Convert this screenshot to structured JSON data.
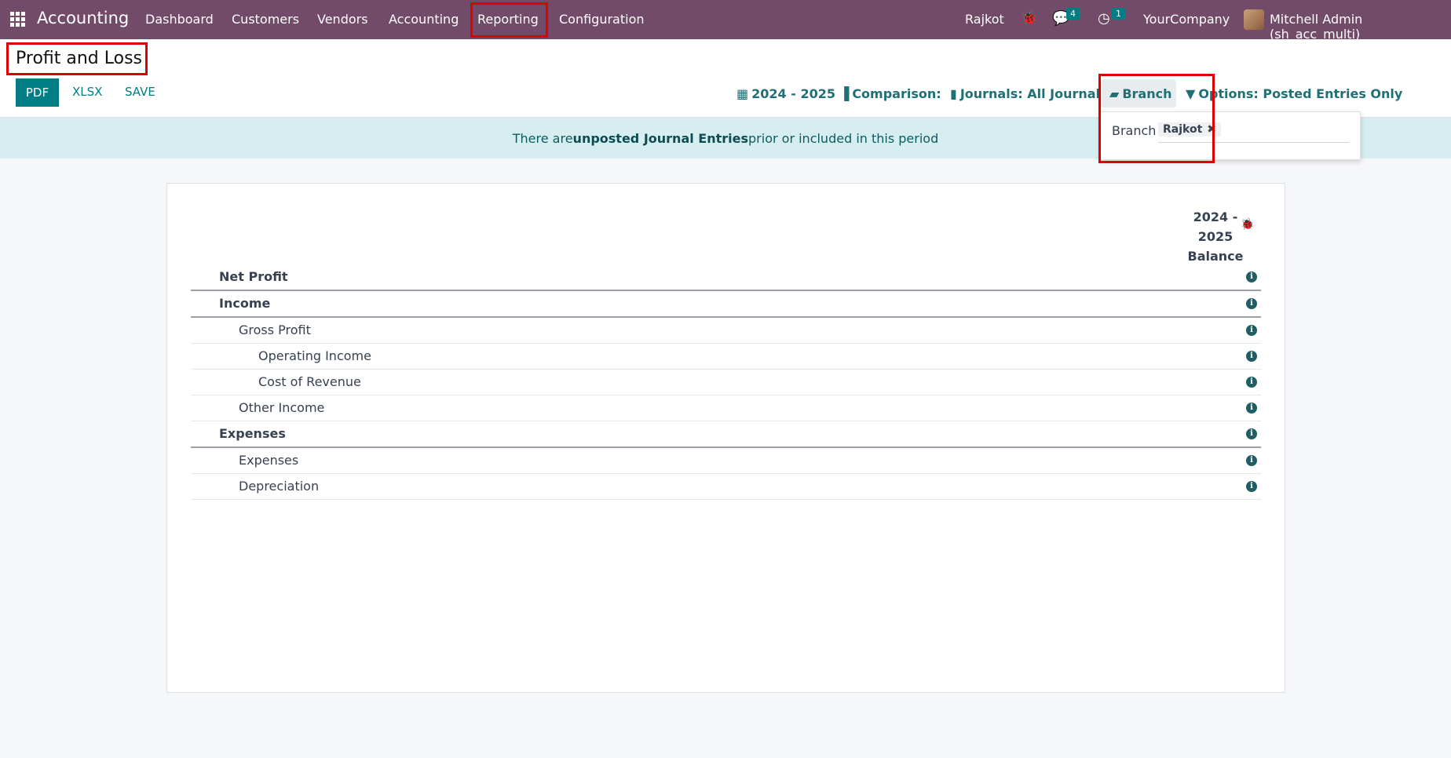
{
  "navbar": {
    "brand": "Accounting",
    "menu": [
      "Dashboard",
      "Customers",
      "Vendors",
      "Accounting",
      "Reporting",
      "Configuration"
    ],
    "branch": "Rajkot",
    "messages_count": "4",
    "activities_count": "1",
    "company": "YourCompany",
    "user": "Mitchell Admin (sh_acc_multi)"
  },
  "page": {
    "title": "Profit and Loss",
    "buttons": {
      "pdf": "PDF",
      "xlsx": "XLSX",
      "save": "SAVE"
    },
    "filters": {
      "period": "2024 - 2025",
      "comparison": "Comparison:",
      "journals": "Journals: All Journals",
      "branch": "Branch",
      "options": "Options: Posted Entries Only"
    }
  },
  "alert": {
    "prefix": "There are ",
    "strong": "unposted Journal Entries",
    "suffix": " prior or included in this period"
  },
  "branch_dropdown": {
    "label": "Branch",
    "selected_tag": "Rajkot"
  },
  "report": {
    "column_header": [
      "2024 -",
      "2025",
      "Balance"
    ],
    "rows": [
      {
        "label": "Net Profit",
        "level": 0,
        "bold": true
      },
      {
        "label": "Income",
        "level": 0,
        "bold": true
      },
      {
        "label": "Gross Profit",
        "level": 1,
        "bold": false
      },
      {
        "label": "Operating Income",
        "level": 2,
        "bold": false
      },
      {
        "label": "Cost of Revenue",
        "level": 2,
        "bold": false
      },
      {
        "label": "Other Income",
        "level": 1,
        "bold": false
      },
      {
        "label": "Expenses",
        "level": 0,
        "bold": true
      },
      {
        "label": "Expenses",
        "level": 1,
        "bold": false
      },
      {
        "label": "Depreciation",
        "level": 1,
        "bold": false
      }
    ]
  },
  "colors": {
    "navbar": "#714b67",
    "primary": "#017e84",
    "highlight": "#e00000",
    "alert_bg": "#d6eef0"
  }
}
